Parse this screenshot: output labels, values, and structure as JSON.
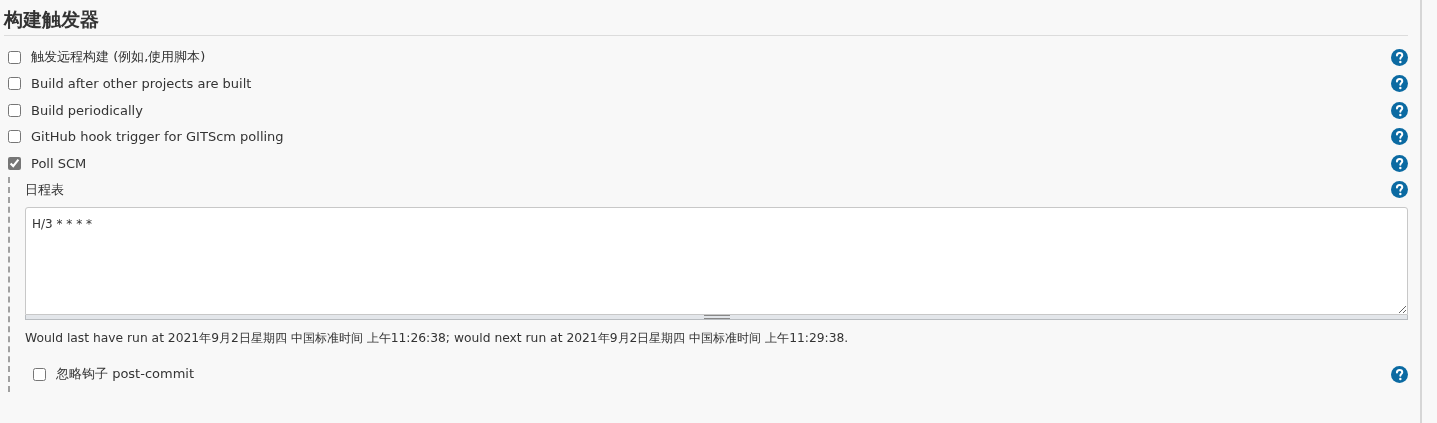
{
  "section_title": "构建触发器",
  "triggers": [
    {
      "label": "触发远程构建 (例如,使用脚本)",
      "checked": false
    },
    {
      "label": "Build after other projects are built",
      "checked": false
    },
    {
      "label": "Build periodically",
      "checked": false
    },
    {
      "label": "GitHub hook trigger for GITScm polling",
      "checked": false
    },
    {
      "label": "Poll SCM",
      "checked": true,
      "options": {
        "schedule_label": "日程表",
        "schedule_value": "H/3 * * * *",
        "run_info": "Would last have run at 2021年9月2日星期四 中国标准时间 上午11:26:38; would next run at 2021年9月2日星期四 中国标准时间 上午11:29:38.",
        "ignore_hook": {
          "label": "忽略钩子 post-commit",
          "checked": false
        }
      }
    }
  ]
}
